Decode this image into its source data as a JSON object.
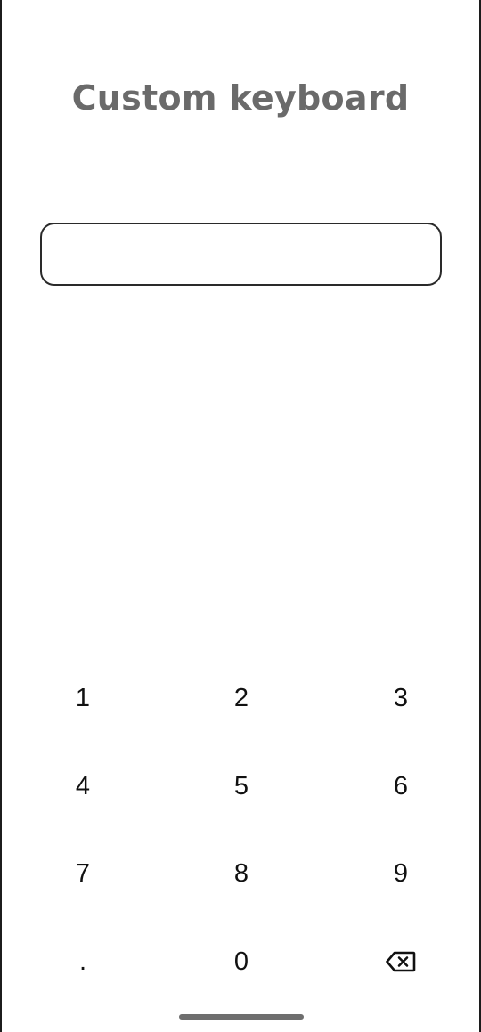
{
  "header": {
    "title": "Custom keyboard"
  },
  "input": {
    "value": "",
    "placeholder": ""
  },
  "keypad": {
    "keys": [
      {
        "label": "1",
        "name": "key-1"
      },
      {
        "label": "2",
        "name": "key-2"
      },
      {
        "label": "3",
        "name": "key-3"
      },
      {
        "label": "4",
        "name": "key-4"
      },
      {
        "label": "5",
        "name": "key-5"
      },
      {
        "label": "6",
        "name": "key-6"
      },
      {
        "label": "7",
        "name": "key-7"
      },
      {
        "label": "8",
        "name": "key-8"
      },
      {
        "label": "9",
        "name": "key-9"
      },
      {
        "label": ".",
        "name": "key-decimal"
      },
      {
        "label": "0",
        "name": "key-0"
      }
    ],
    "backspace_icon": "backspace-icon"
  },
  "colors": {
    "title": "#6a6a6a",
    "field_border": "#2a2a2a",
    "key_text": "#111111",
    "nav_handle": "#6e6e6e"
  }
}
